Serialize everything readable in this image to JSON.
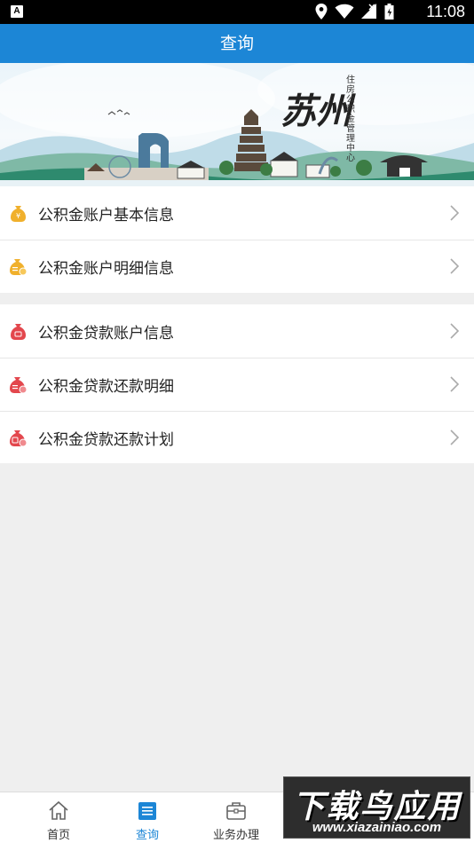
{
  "status_bar": {
    "time": "11:08",
    "icons": [
      "location-icon",
      "wifi-icon",
      "signal-icon",
      "battery-icon"
    ]
  },
  "title_bar": {
    "title": "查询"
  },
  "banner": {
    "calligraphy": "苏州",
    "subtitle": "住房公积金管理中心"
  },
  "menu_groups": [
    {
      "items": [
        {
          "label": "公积金账户基本信息",
          "icon": "gold-coin-bag-icon"
        },
        {
          "label": "公积金账户明细信息",
          "icon": "gold-coin-bag-list-icon"
        }
      ]
    },
    {
      "items": [
        {
          "label": "公积金贷款账户信息",
          "icon": "red-loan-bag-icon"
        },
        {
          "label": "公积金贷款还款明细",
          "icon": "red-loan-bag-detail-icon"
        },
        {
          "label": "公积金贷款还款计划",
          "icon": "red-loan-bag-plan-icon"
        }
      ]
    }
  ],
  "bottom_nav": {
    "tabs": [
      {
        "label": "首页",
        "icon": "home-icon",
        "active": false
      },
      {
        "label": "查询",
        "icon": "document-list-icon",
        "active": true
      },
      {
        "label": "业务办理",
        "icon": "briefcase-icon",
        "active": false
      }
    ]
  },
  "watermark": {
    "title": "下载鸟应用",
    "url": "www.xiazainiao.com"
  },
  "colors": {
    "primary": "#1c86d6",
    "gold": "#f0b02c",
    "red": "#e3474d",
    "background": "#efefef"
  }
}
